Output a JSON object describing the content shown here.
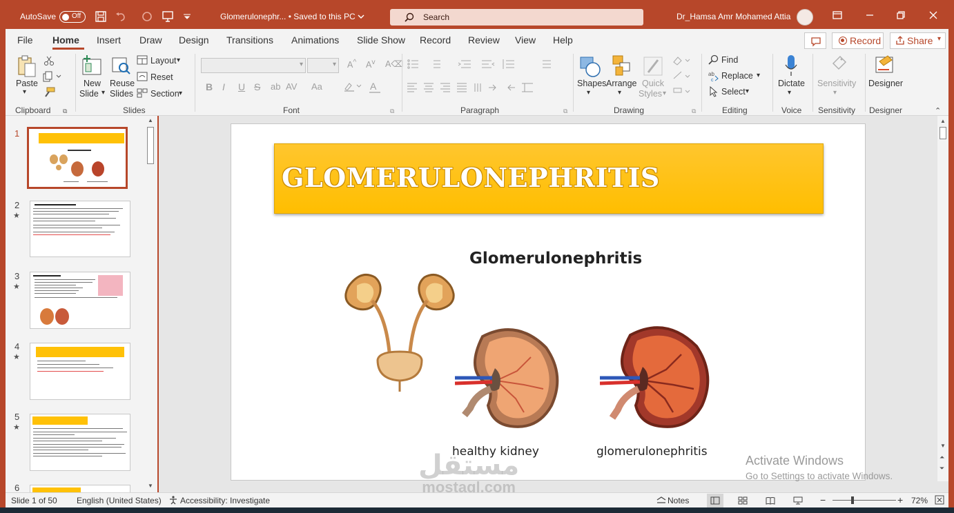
{
  "titlebar": {
    "autosave_label": "AutoSave",
    "autosave_state": "Off",
    "doc_title": "Glomerulonephr...  •  Saved to this PC",
    "search_placeholder": "Search",
    "user_name": "Dr_Hamsa Amr Mohamed Attia"
  },
  "menu": {
    "tabs": [
      "File",
      "Home",
      "Insert",
      "Draw",
      "Design",
      "Transitions",
      "Animations",
      "Slide Show",
      "Record",
      "Review",
      "View",
      "Help"
    ],
    "active_tab": "Home",
    "record_label": "Record",
    "share_label": "Share"
  },
  "ribbon": {
    "clipboard": {
      "paste": "Paste",
      "label": "Clipboard"
    },
    "slides": {
      "new_slide_1": "New",
      "new_slide_2": "Slide",
      "reuse_1": "Reuse",
      "reuse_2": "Slides",
      "layout": "Layout",
      "reset": "Reset",
      "section": "Section",
      "label": "Slides"
    },
    "font": {
      "label": "Font",
      "bold": "B",
      "italic": "I",
      "underline": "U",
      "strike": "S",
      "spacing": "AV",
      "case": "Aa",
      "color": "A"
    },
    "paragraph": {
      "label": "Paragraph"
    },
    "drawing": {
      "shapes": "Shapes",
      "arrange": "Arrange",
      "quick_1": "Quick",
      "quick_2": "Styles",
      "label": "Drawing"
    },
    "editing": {
      "find": "Find",
      "replace": "Replace",
      "select": "Select",
      "label": "Editing"
    },
    "voice": {
      "dictate": "Dictate",
      "label": "Voice"
    },
    "sensitivity": {
      "button": "Sensitivity",
      "label": "Sensitivity"
    },
    "designer": {
      "button": "Designer",
      "label": "Designer"
    }
  },
  "thumbnails": {
    "items": [
      {
        "num": "1",
        "active": true,
        "starred": false
      },
      {
        "num": "2",
        "active": false,
        "starred": true
      },
      {
        "num": "3",
        "active": false,
        "starred": true
      },
      {
        "num": "4",
        "active": false,
        "starred": true
      },
      {
        "num": "5",
        "active": false,
        "starred": true
      },
      {
        "num": "6",
        "active": false,
        "starred": false
      }
    ]
  },
  "slide": {
    "title": "GLOMERULONEPHRITIS",
    "image_title": "Glomerulonephritis",
    "caption_left": "healthy kidney",
    "caption_right": "glomerulonephritis"
  },
  "activation": {
    "line1": "Activate Windows",
    "line2": "Go to Settings to activate Windows."
  },
  "watermark": {
    "arabic": "مستقل",
    "latin": "mostaql.com"
  },
  "status": {
    "slide_info": "Slide 1 of 50",
    "language": "English (United States)",
    "accessibility": "Accessibility: Investigate",
    "notes": "Notes",
    "zoom": "72%"
  },
  "colors": {
    "accent": "#b7472a",
    "title_fill": "#ffc000"
  }
}
